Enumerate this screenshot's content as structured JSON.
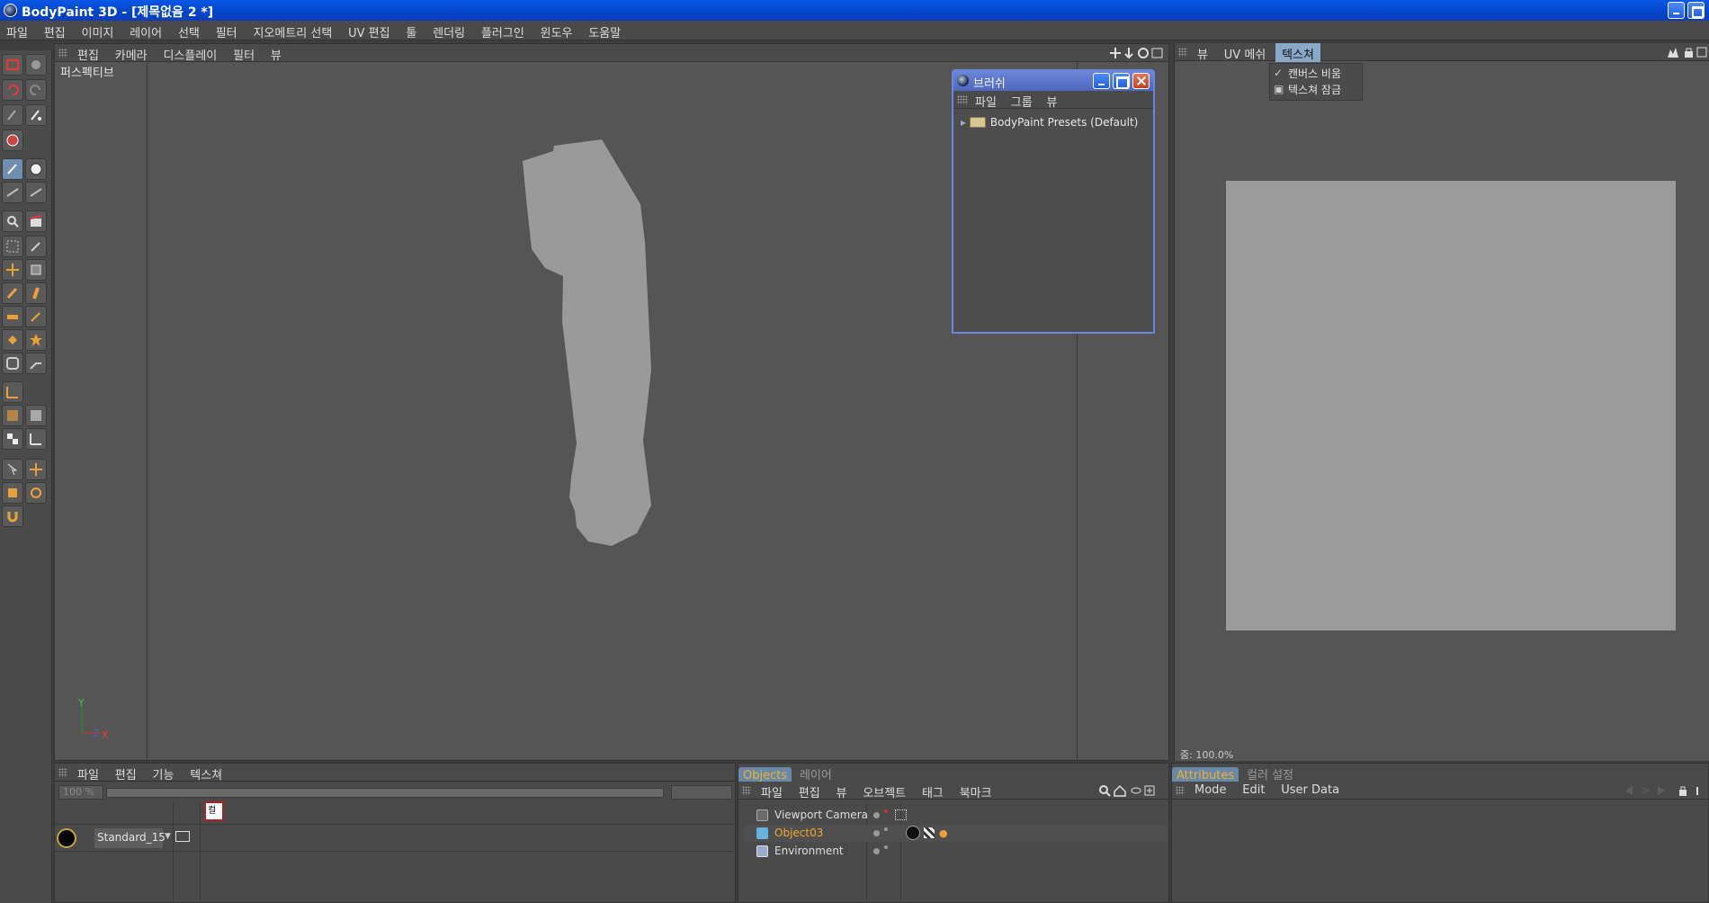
{
  "app": {
    "title": "BodyPaint 3D - [제목없음 2 *]"
  },
  "menubar": {
    "items": [
      "파일",
      "편집",
      "이미지",
      "레이어",
      "선택",
      "필터",
      "지오메트리 선택",
      "UV 편집",
      "툴",
      "렌더링",
      "플러그인",
      "윈도우",
      "도움말"
    ]
  },
  "viewport": {
    "menu": [
      "편집",
      "카메라",
      "디스플레이",
      "필터",
      "뷰"
    ],
    "label": "퍼스펙티브",
    "axis": {
      "y": "Y",
      "z": "Z",
      "x": "X"
    },
    "model_color": "#9a9a9a"
  },
  "brush_window": {
    "title": "브러쉬",
    "menu": [
      "파일",
      "그룹",
      "뷰"
    ],
    "tree_item": "BodyPaint Presets (Default)"
  },
  "texture_panel": {
    "tabs": [
      "뷰",
      "UV 메쉬",
      "텍스쳐"
    ],
    "selected_tab": "텍스쳐",
    "dropdown": [
      "캔버스 비움",
      "텍스쳐 잠금"
    ],
    "zoom": "줌: 100.0%",
    "canvas_color": "#9b9b9b"
  },
  "materials_panel": {
    "menu": [
      "파일",
      "편집",
      "기능",
      "텍스쳐"
    ],
    "zoom_field": "100 %",
    "channel_label": "컬",
    "material_name": "Standard_15"
  },
  "objects_panel": {
    "tabs": [
      "Objects",
      "레이어"
    ],
    "active_tab": "Objects",
    "menu": [
      "파일",
      "편집",
      "뷰",
      "오브젝트",
      "태그",
      "북마크"
    ],
    "rows": [
      {
        "name": "Viewport Camera",
        "icon": "camera-icon",
        "selected": false
      },
      {
        "name": "Object03",
        "icon": "polygon-object-icon",
        "selected": true
      },
      {
        "name": "Environment",
        "icon": "environment-icon",
        "selected": false
      }
    ]
  },
  "attributes_panel": {
    "tabs": [
      "Attributes",
      "컬러 설정"
    ],
    "active_tab": "Attributes",
    "menu": [
      "Mode",
      "Edit",
      "User Data"
    ]
  },
  "colors": {
    "accent": "#6a88a8",
    "title_blue": "#0244c8",
    "active_text": "#f0b030"
  }
}
